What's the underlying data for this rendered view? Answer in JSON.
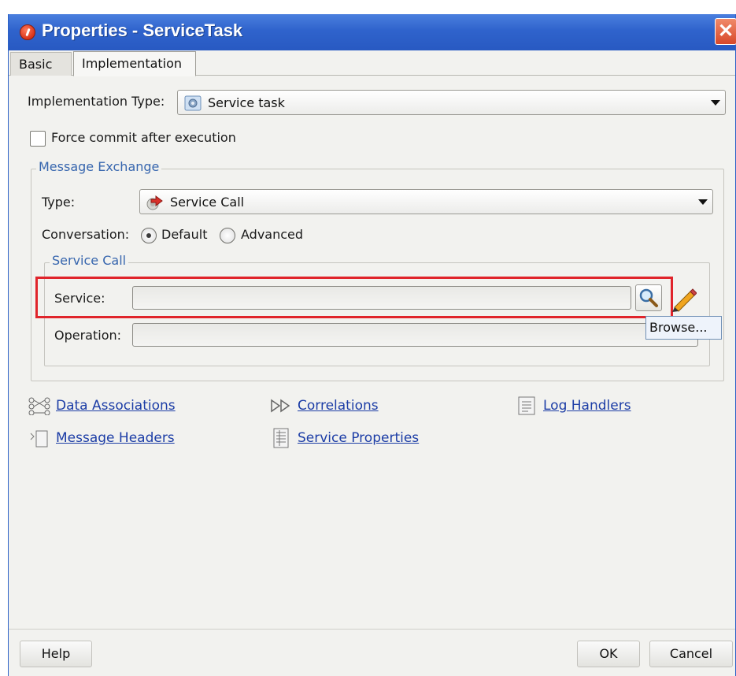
{
  "window": {
    "title": "Properties - ServiceTask",
    "close_symbol": "✕"
  },
  "tabs": [
    {
      "label": "Basic",
      "selected": false
    },
    {
      "label": "Implementation",
      "selected": true
    }
  ],
  "implementation_type": {
    "label": "Implementation Type:",
    "value": "Service task"
  },
  "force_commit": {
    "label": "Force commit after execution",
    "checked": false
  },
  "message_exchange": {
    "title": "Message Exchange",
    "type_label": "Type:",
    "type_value": "Service Call",
    "conversation_label": "Conversation:",
    "conversation_options": [
      {
        "label": "Default",
        "selected": true
      },
      {
        "label": "Advanced",
        "selected": false
      }
    ]
  },
  "service_call": {
    "title": "Service Call",
    "service_label": "Service:",
    "service_value": "",
    "operation_label": "Operation:",
    "operation_value": "",
    "tooltip": "Browse...",
    "highlight_color": "#e0242b"
  },
  "links": {
    "data_associations": "Data Associations",
    "correlations": "Correlations",
    "log_handlers": "Log Handlers",
    "message_headers": "Message Headers",
    "service_properties": "Service Properties"
  },
  "buttons": {
    "help": "Help",
    "ok": "OK",
    "cancel": "Cancel"
  },
  "colors": {
    "titlebar": "#2f63cc",
    "link": "#1c3da6",
    "group_title": "#3766ae"
  }
}
